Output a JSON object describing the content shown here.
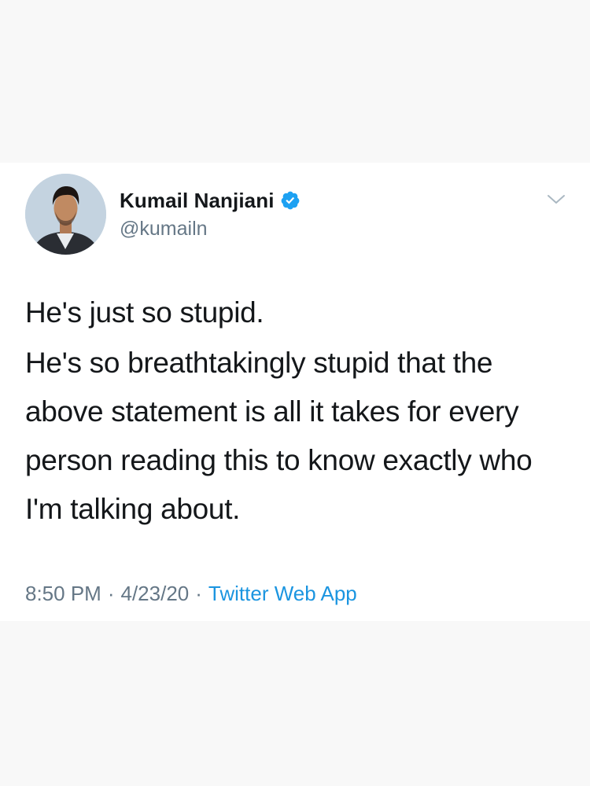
{
  "tweet": {
    "author": {
      "display_name": "Kumail Nanjiani",
      "handle": "@kumailn",
      "verified": true
    },
    "text_paragraphs": [
      "He's just so stupid.",
      "He's so breathtakingly stupid that the above statement is all it takes for every person reading this to know exactly who I'm talking about."
    ],
    "time": "8:50 PM",
    "separator": "·",
    "date": "4/23/20",
    "source": "Twitter Web App"
  },
  "colors": {
    "page_background": "#f8f8f8",
    "card_background": "#ffffff",
    "text_primary": "#14171a",
    "text_secondary": "#657786",
    "link_blue": "#1b95e0",
    "verified_blue": "#1da1f2"
  },
  "icons": {
    "verified": "verified-badge-icon",
    "menu": "chevron-down-icon"
  }
}
